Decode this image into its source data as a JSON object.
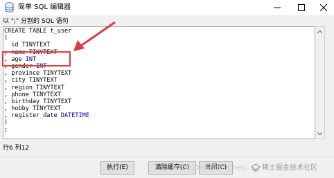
{
  "window": {
    "title": "简单 SQL 编辑器",
    "icon": "database-icon",
    "controls": [
      "minimize",
      "maximize",
      "close"
    ]
  },
  "hint": "以 \";\" 分割的 SQL 语句",
  "editor": {
    "lines": [
      {
        "tokens": [
          {
            "text": "CREATE TABLE t_user",
            "kw": false
          }
        ]
      },
      {
        "tokens": [
          {
            "text": "(",
            "kw": false
          }
        ]
      },
      {
        "tokens": [
          {
            "text": "  id TINYTEXT",
            "kw": false
          }
        ]
      },
      {
        "tokens": [
          {
            "text": ", name TINYTEXT",
            "kw": false
          }
        ]
      },
      {
        "tokens": [
          {
            "text": ", age ",
            "kw": false
          },
          {
            "text": "INT",
            "kw": true
          }
        ]
      },
      {
        "tokens": [
          {
            "text": ", gender ",
            "kw": false
          },
          {
            "text": "INT",
            "kw": true
          }
        ]
      },
      {
        "tokens": [
          {
            "text": ", province TINYTEXT",
            "kw": false
          }
        ]
      },
      {
        "tokens": [
          {
            "text": ", city TINYTEXT",
            "kw": false
          }
        ]
      },
      {
        "tokens": [
          {
            "text": ", region TINYTEXT",
            "kw": false
          }
        ]
      },
      {
        "tokens": [
          {
            "text": ", phone TINYTEXT",
            "kw": false
          }
        ]
      },
      {
        "tokens": [
          {
            "text": ", birthday TINYTEXT",
            "kw": false
          }
        ]
      },
      {
        "tokens": [
          {
            "text": ", hobby TINYTEXT",
            "kw": false
          }
        ]
      },
      {
        "tokens": [
          {
            "text": ", register_date ",
            "kw": false
          },
          {
            "text": "DATETIME",
            "kw": true
          }
        ]
      },
      {
        "tokens": [
          {
            "text": ")",
            "kw": false
          }
        ]
      },
      {
        "tokens": [
          {
            "text": ";",
            "kw": false
          }
        ]
      }
    ],
    "keyword_color": "#0000c8"
  },
  "annotation": {
    "color": "#d93c3c"
  },
  "status": {
    "cursor": "行6 列12"
  },
  "buttons": {
    "execute": "执行(E)",
    "clear_cache": "清除缓存(C)",
    "close": "关闭(C)"
  },
  "watermark": {
    "url": "https://blog.csdn.net/...",
    "brand": "稀土掘金技术社区"
  }
}
